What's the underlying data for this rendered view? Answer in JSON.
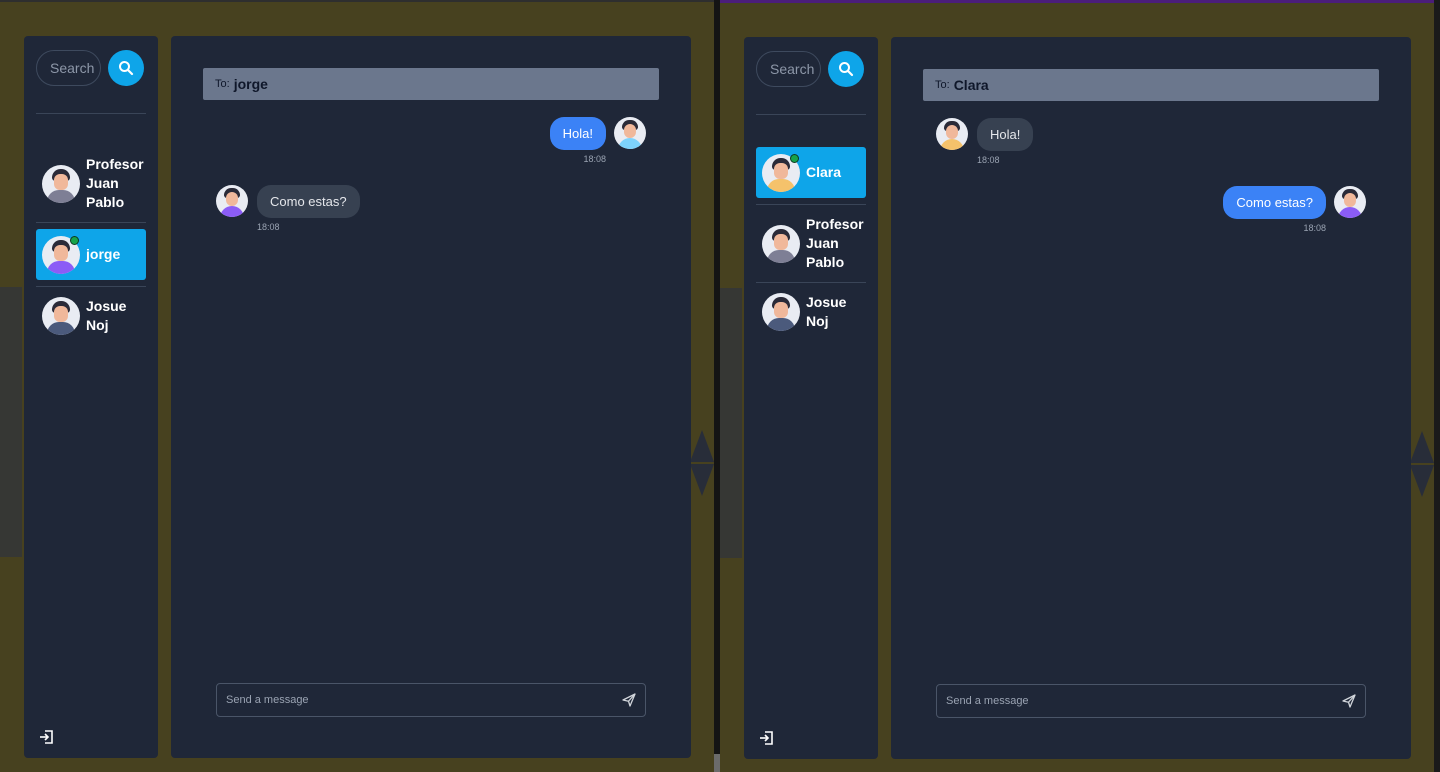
{
  "search": {
    "placeholder": "Search"
  },
  "composer": {
    "placeholder": "Send a message"
  },
  "colors": {
    "accent": "#0ea5e9",
    "bubble_out": "#3b82f6",
    "bubble_in": "#374151",
    "panel": "#1f2738",
    "backdrop": "#47411f"
  },
  "left": {
    "contacts": [
      {
        "name": "Profesor Juan Pablo"
      },
      {
        "name": "jorge"
      },
      {
        "name": "Josue Noj"
      }
    ],
    "to_label": "To:",
    "to_name": "jorge",
    "messages": [
      {
        "text": "Hola!",
        "time": "18:08",
        "direction": "out"
      },
      {
        "text": "Como estas?",
        "time": "18:08",
        "direction": "in"
      }
    ]
  },
  "right": {
    "contacts": [
      {
        "name": "Clara"
      },
      {
        "name": "Profesor Juan Pablo"
      },
      {
        "name": "Josue Noj"
      }
    ],
    "to_label": "To:",
    "to_name": "Clara",
    "messages": [
      {
        "text": "Hola!",
        "time": "18:08",
        "direction": "in"
      },
      {
        "text": "Como estas?",
        "time": "18:08",
        "direction": "out"
      }
    ]
  },
  "icons": [
    "search-icon",
    "send-icon",
    "logout-icon"
  ]
}
